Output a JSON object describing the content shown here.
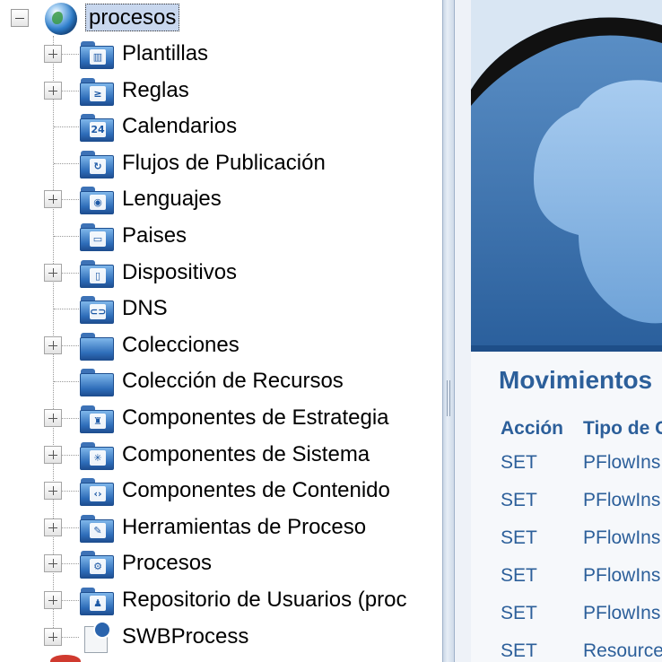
{
  "tree": {
    "root_label": "procesos",
    "nodes": [
      {
        "label": "Plantillas",
        "expandable": true,
        "icon": "templates-folder-icon",
        "glyph": "▥"
      },
      {
        "label": "Reglas",
        "expandable": true,
        "icon": "rules-folder-icon",
        "glyph": "≥"
      },
      {
        "label": "Calendarios",
        "expandable": false,
        "icon": "calendar-folder-icon",
        "glyph": "24"
      },
      {
        "label": "Flujos de Publicación",
        "expandable": false,
        "icon": "workflow-folder-icon",
        "glyph": "↻"
      },
      {
        "label": "Lenguajes",
        "expandable": true,
        "icon": "languages-folder-icon",
        "glyph": "◉"
      },
      {
        "label": "Paises",
        "expandable": false,
        "icon": "countries-folder-icon",
        "glyph": "▭"
      },
      {
        "label": "Dispositivos",
        "expandable": true,
        "icon": "devices-folder-icon",
        "glyph": "▯"
      },
      {
        "label": "DNS",
        "expandable": false,
        "icon": "dns-folder-icon",
        "glyph": "⊂⊃"
      },
      {
        "label": "Colecciones",
        "expandable": true,
        "icon": "collections-folder-icon",
        "glyph": ""
      },
      {
        "label": "Colección de Recursos",
        "expandable": false,
        "icon": "resource-collection-folder-icon",
        "glyph": ""
      },
      {
        "label": "Componentes de Estrategia",
        "expandable": true,
        "icon": "strategy-components-folder-icon",
        "glyph": "♜"
      },
      {
        "label": "Componentes de Sistema",
        "expandable": true,
        "icon": "system-components-folder-icon",
        "glyph": "✳"
      },
      {
        "label": "Componentes de Contenido",
        "expandable": true,
        "icon": "content-components-folder-icon",
        "glyph": "‹›"
      },
      {
        "label": "Herramientas de Proceso",
        "expandable": true,
        "icon": "process-tools-folder-icon",
        "glyph": "✎"
      },
      {
        "label": "Procesos",
        "expandable": true,
        "icon": "processes-folder-icon",
        "glyph": "⚙"
      },
      {
        "label": "Repositorio de Usuarios (proc",
        "expandable": true,
        "icon": "user-repository-folder-icon",
        "glyph": "♟"
      },
      {
        "label": "SWBProcess",
        "expandable": true,
        "icon": "process-document-icon",
        "glyph": ""
      }
    ]
  },
  "content": {
    "section_title": "Movimientos",
    "columns": [
      "Acción",
      "Tipo de C"
    ],
    "rows": [
      {
        "action": "SET",
        "type": "PFlowIns"
      },
      {
        "action": "SET",
        "type": "PFlowIns"
      },
      {
        "action": "SET",
        "type": "PFlowIns"
      },
      {
        "action": "SET",
        "type": "PFlowIns"
      },
      {
        "action": "SET",
        "type": "PFlowIns"
      },
      {
        "action": "SET",
        "type": "Resource"
      }
    ]
  }
}
